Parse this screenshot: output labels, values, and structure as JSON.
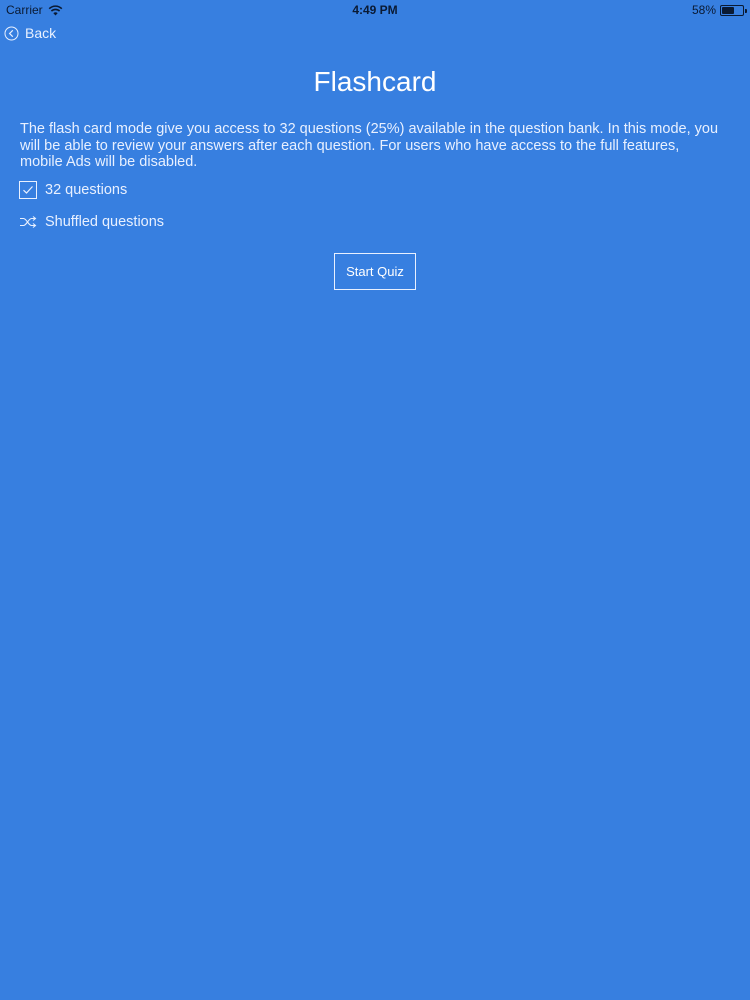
{
  "status_bar": {
    "carrier": "Carrier",
    "time": "4:49 PM",
    "battery": "58%",
    "battery_level": 0.58
  },
  "nav": {
    "back_label": "Back"
  },
  "page": {
    "title": "Flashcard",
    "description": "The flash card mode give you access to 32 questions (25%) available in the question bank. In this mode, you will be able to review your answers after each question. For users who have access to the full features, mobile Ads will be disabled."
  },
  "options": {
    "questions_label": "32 questions",
    "shuffled_label": "Shuffled questions"
  },
  "actions": {
    "start_label": "Start Quiz"
  },
  "colors": {
    "background": "#377fe0",
    "text": "#ffffff"
  }
}
